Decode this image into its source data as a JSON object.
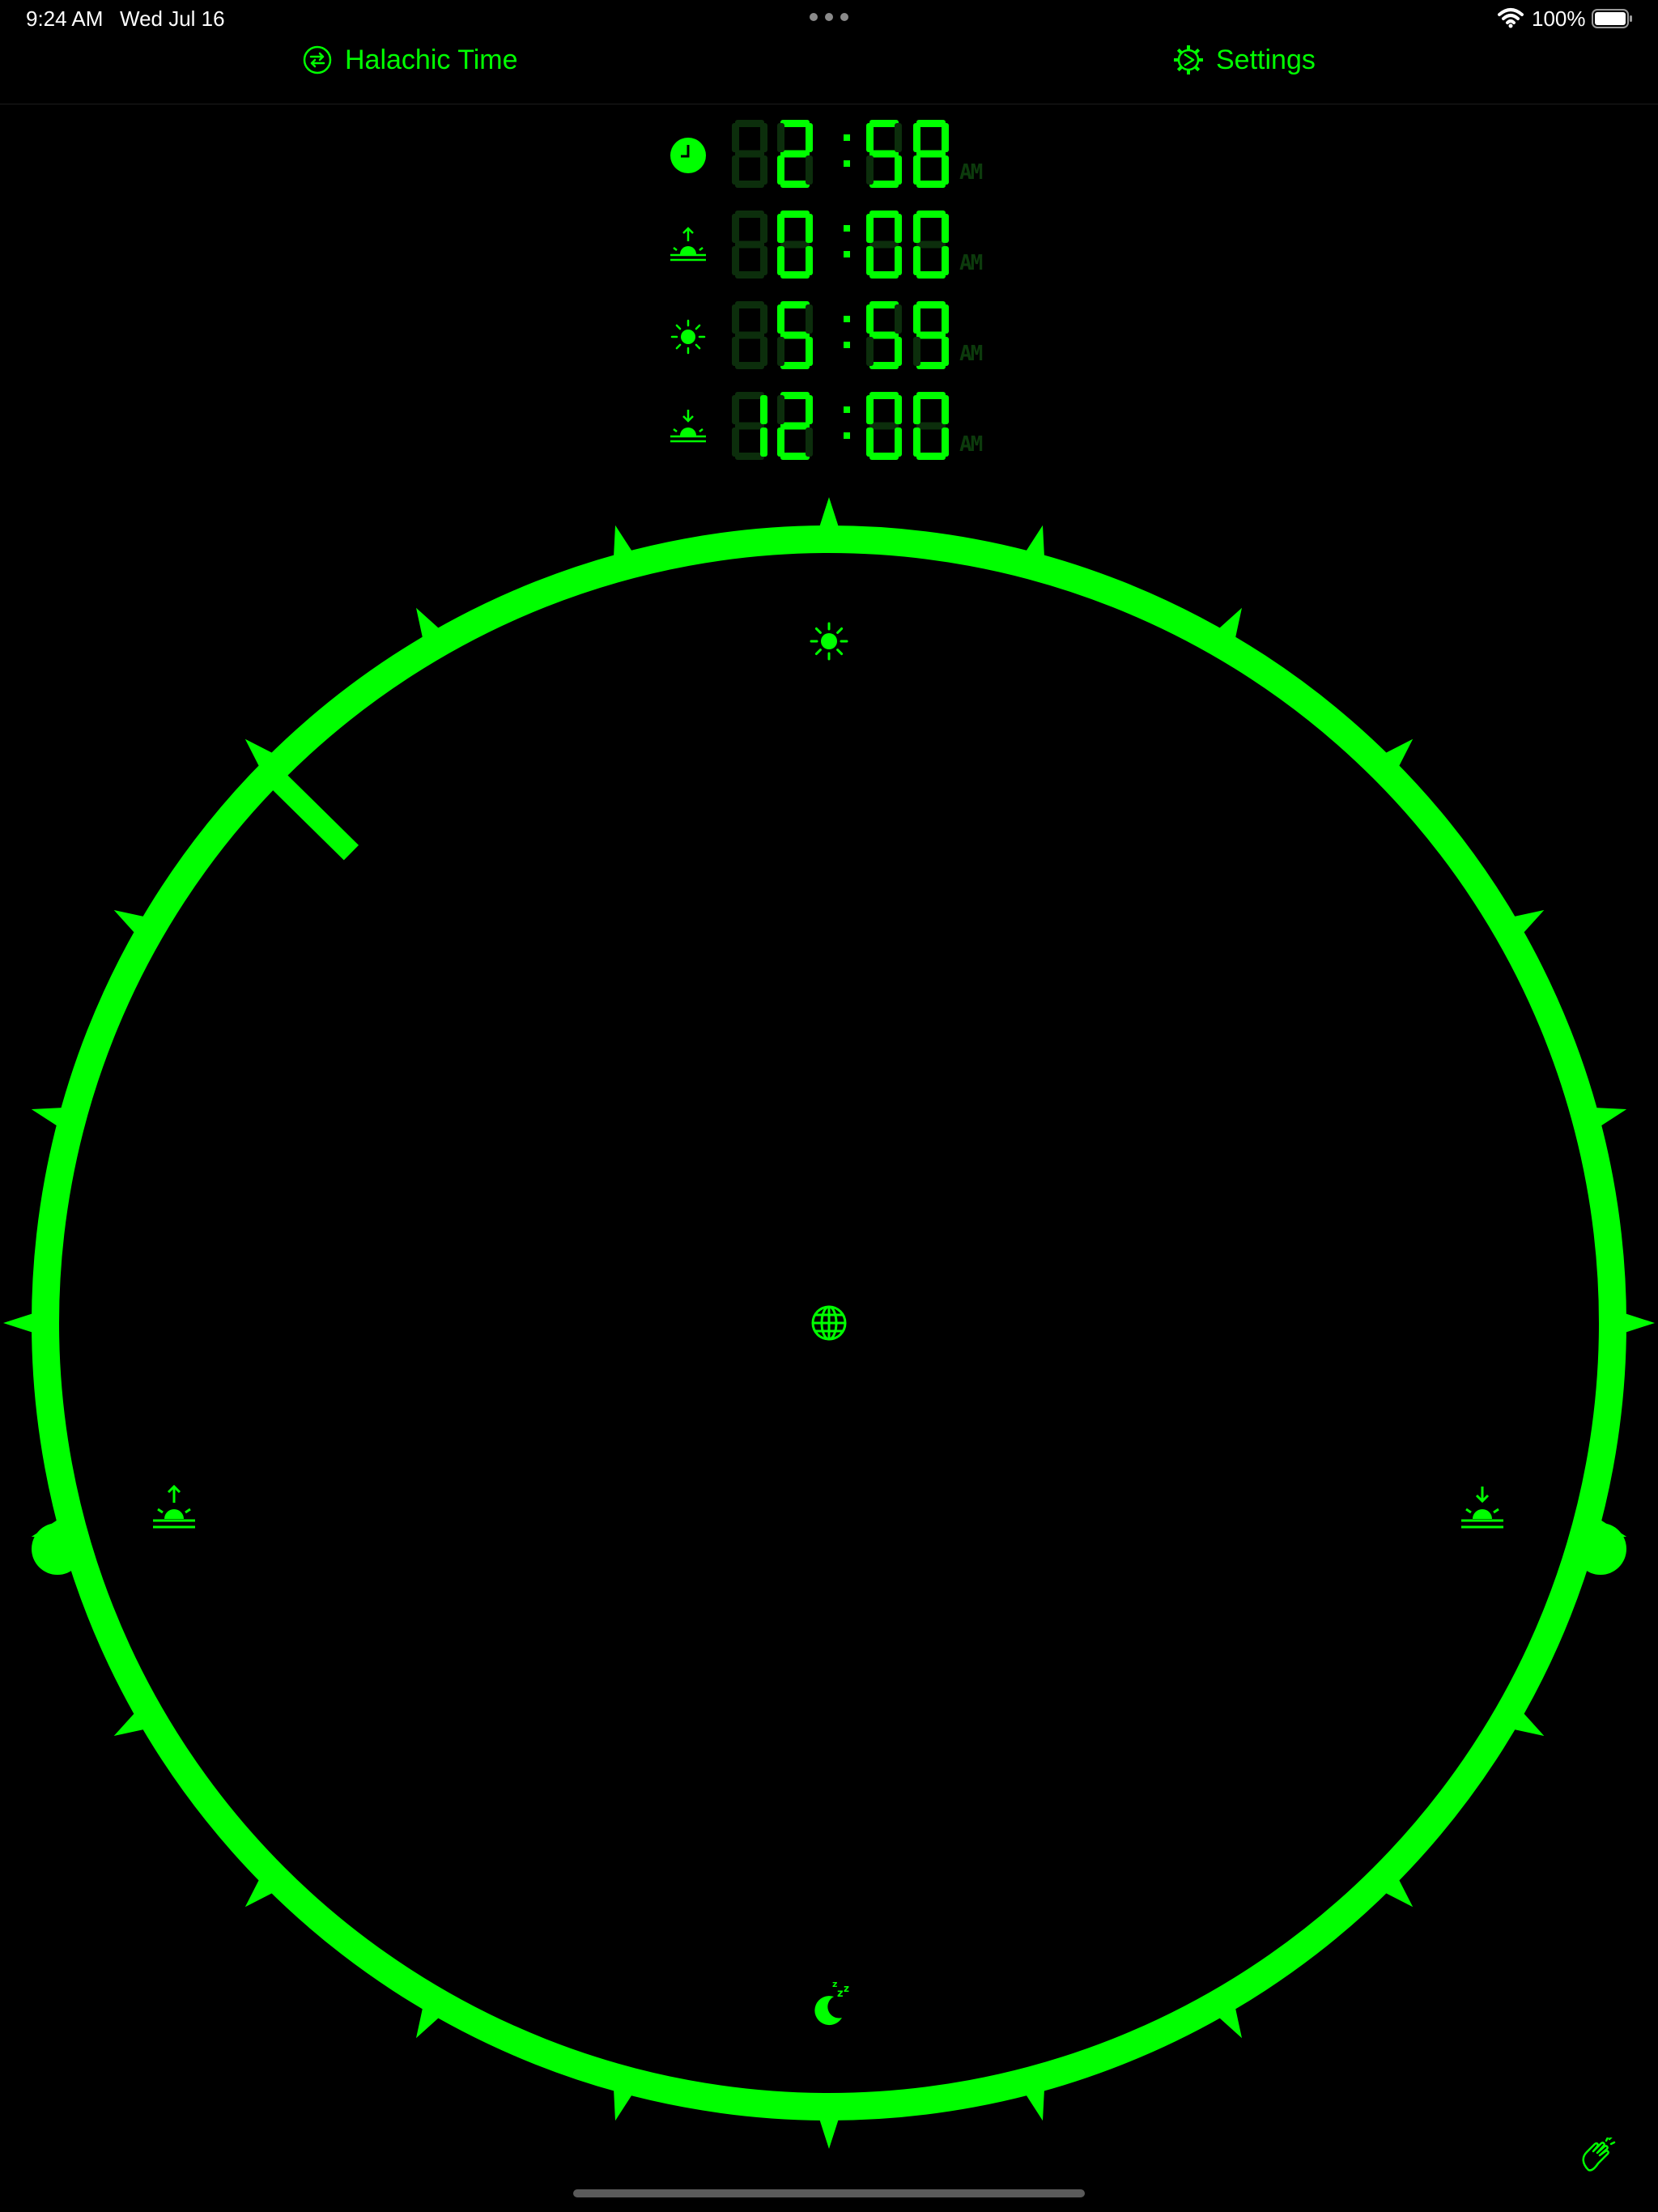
{
  "status_bar": {
    "time": "9:24 AM",
    "date": "Wed Jul 16",
    "battery_percent": "100%",
    "battery_level": 1.0
  },
  "toolbar": {
    "halachic_time_label": "Halachic Time",
    "settings_label": "Settings"
  },
  "readouts": [
    {
      "icon": "clock-icon",
      "value": "2:58",
      "ampm": "AM"
    },
    {
      "icon": "sunrise-icon",
      "value": "0:00",
      "ampm": "AM"
    },
    {
      "icon": "sun-icon",
      "value": "5:59",
      "ampm": "AM"
    },
    {
      "icon": "sunset-icon",
      "value": "12:00",
      "ampm": "AM"
    }
  ],
  "clock": {
    "markers": {
      "top": "sun-icon",
      "center": "globe-icon",
      "left": "sunrise-icon",
      "right": "sunset-icon",
      "bottom": "moon-sleep-icon"
    },
    "hand_hour": 2.97,
    "sunrise_hour": 0,
    "sunset_hour": 12,
    "ticks_per_revolution": 24
  },
  "colors": {
    "accent": "#00ff00",
    "dim_segment": "#0c2e0c",
    "background": "#000000"
  },
  "bottom_icon": "clapping-hands-icon"
}
